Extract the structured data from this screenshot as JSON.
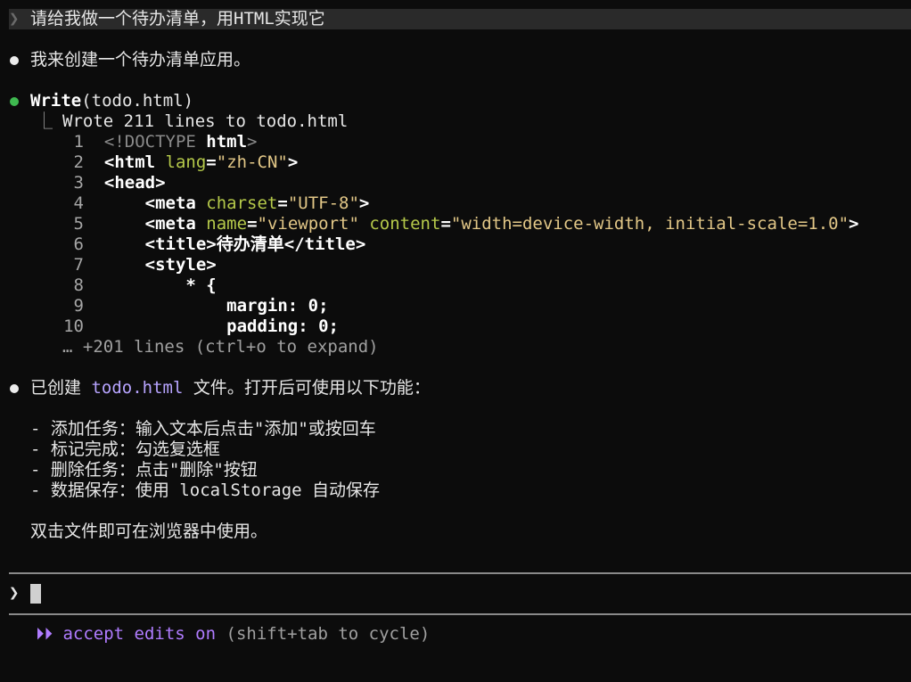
{
  "user_prompt": {
    "caret": "❯",
    "text": "请给我做一个待办清单，用HTML实现它"
  },
  "reply_1": "我来创建一个待办清单应用。",
  "tool_call": {
    "name": "Write",
    "arg": "(todo.html)",
    "result_prefix": "⎿ ",
    "result_text": "Wrote 211 lines to todo.html",
    "code_lines": [
      {
        "n": "1",
        "indent": "",
        "parts": [
          [
            "dtc",
            "<!DOCTYPE "
          ],
          [
            "plain",
            "html"
          ],
          [
            "dtc",
            ">"
          ]
        ]
      },
      {
        "n": "2",
        "indent": "",
        "parts": [
          [
            "plain",
            "<html "
          ],
          [
            "attr",
            "lang"
          ],
          [
            "plain",
            "="
          ],
          [
            "str",
            "\"zh-CN\""
          ],
          [
            "plain",
            ">"
          ]
        ]
      },
      {
        "n": "3",
        "indent": "",
        "parts": [
          [
            "plain",
            "<head>"
          ]
        ]
      },
      {
        "n": "4",
        "indent": "    ",
        "parts": [
          [
            "plain",
            "<meta "
          ],
          [
            "attr",
            "charset"
          ],
          [
            "plain",
            "="
          ],
          [
            "str",
            "\"UTF-8\""
          ],
          [
            "plain",
            ">"
          ]
        ]
      },
      {
        "n": "5",
        "indent": "    ",
        "parts": [
          [
            "plain",
            "<meta "
          ],
          [
            "attr",
            "name"
          ],
          [
            "plain",
            "="
          ],
          [
            "str",
            "\"viewport\""
          ],
          [
            "plain",
            " "
          ],
          [
            "attr",
            "content"
          ],
          [
            "plain",
            "="
          ],
          [
            "str",
            "\"width=device-width, initial-scale=1.0\""
          ],
          [
            "plain",
            ">"
          ]
        ]
      },
      {
        "n": "6",
        "indent": "    ",
        "parts": [
          [
            "plain",
            "<title>"
          ],
          [
            "plain",
            "待办清单"
          ],
          [
            "plain",
            "</title>"
          ]
        ]
      },
      {
        "n": "7",
        "indent": "    ",
        "parts": [
          [
            "plain",
            "<style>"
          ]
        ]
      },
      {
        "n": "8",
        "indent": "        ",
        "parts": [
          [
            "plain",
            "* {"
          ]
        ]
      },
      {
        "n": "9",
        "indent": "            ",
        "parts": [
          [
            "plain",
            "margin: 0;"
          ]
        ]
      },
      {
        "n": "10",
        "indent": "            ",
        "parts": [
          [
            "plain",
            "padding: 0;"
          ]
        ]
      }
    ],
    "more_text": "… +201 lines (ctrl+o to expand)"
  },
  "reply_2": {
    "prefix": "已创建 ",
    "file": "todo.html",
    "suffix": " 文件。打开后可使用以下功能："
  },
  "features": [
    "- 添加任务：输入文本后点击\"添加\"或按回车",
    "- 标记完成：勾选复选框",
    "- 删除任务：点击\"删除\"按钮",
    "- 数据保存：使用 localStorage 自动保存"
  ],
  "closing": "双击文件即可在浏览器中使用。",
  "input": {
    "caret": "❯",
    "value": ""
  },
  "mode": {
    "arrows": "⏵⏵",
    "label": "accept edits on",
    "hint": "(shift+tab to cycle)"
  },
  "colors": {
    "background": "#0c0c0c",
    "success_dot": "#3fb950",
    "file_link": "#b7a4ff",
    "mode_accent": "#b07cff"
  }
}
